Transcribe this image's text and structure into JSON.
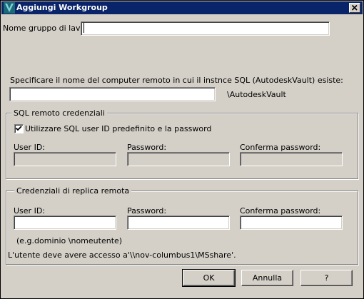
{
  "window": {
    "title": "Aggiungi Workgroup"
  },
  "workgroup": {
    "label": "Nome gruppo di lavoro:",
    "value": ""
  },
  "remote": {
    "prompt": "Specificare il nome del computer remoto in cui il instnce SQL (AutodeskVault) esiste:",
    "computer_value": "",
    "suffix": "\\AutodeskVault"
  },
  "sql_credentials": {
    "title": "SQL remoto credenziali",
    "checkbox_label": "Utilizzare SQL user ID predefinito e la password",
    "checkbox_checked": true,
    "userid_label": "User ID:",
    "password_label": "Password:",
    "confirm_label": "Conferma password:"
  },
  "replica_credentials": {
    "title": "Credenziali di replica remota",
    "userid_label": "User ID:",
    "password_label": "Password:",
    "confirm_label": "Conferma password:",
    "hint": "(e.g.dominio \\nomeutente)"
  },
  "access_note": "L'utente deve avere accesso a'\\\\nov-columbus1\\MSshare'.",
  "buttons": {
    "ok": "OK",
    "cancel": "Annulla",
    "help": "?"
  }
}
